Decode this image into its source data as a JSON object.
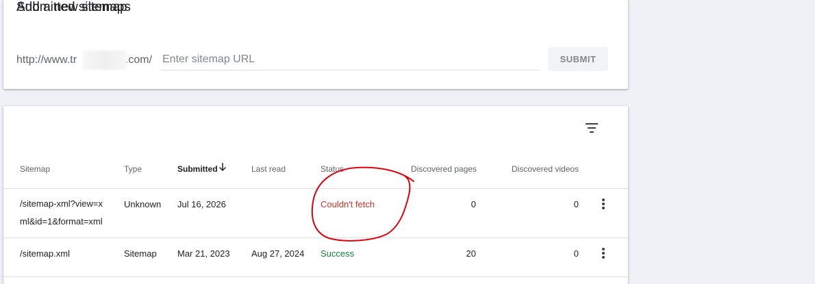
{
  "add_sitemap": {
    "title": "Add a new sitemap",
    "url_prefix": "http://www.tr",
    "url_suffix": "p.com/",
    "input_placeholder": "Enter sitemap URL",
    "input_value": "",
    "submit_label": "SUBMIT"
  },
  "submitted": {
    "title": "Submitted sitemaps",
    "columns": [
      "Sitemap",
      "Type",
      "Submitted",
      "Last read",
      "Status",
      "Discovered pages",
      "Discovered videos"
    ],
    "sort_column": "Submitted",
    "rows": [
      {
        "sitemap": "/sitemap-xml?view=xml&id=1&format=xml",
        "type": "Unknown",
        "submitted": "Jul 16, 2026",
        "last_read": "",
        "status": "Couldn't fetch",
        "pages": "0",
        "videos": "0"
      },
      {
        "sitemap": "/sitemap.xml",
        "type": "Sitemap",
        "submitted": "Mar 21, 2023",
        "last_read": "Aug 27, 2024",
        "status": "Success",
        "pages": "20",
        "videos": "0"
      }
    ]
  },
  "colors": {
    "background": "#eff1f6",
    "error": "#d93025",
    "success": "#188038",
    "annotation": "#e0000a"
  },
  "icons": [
    "filter-icon",
    "arrow-down-icon",
    "more-vert-icon"
  ]
}
